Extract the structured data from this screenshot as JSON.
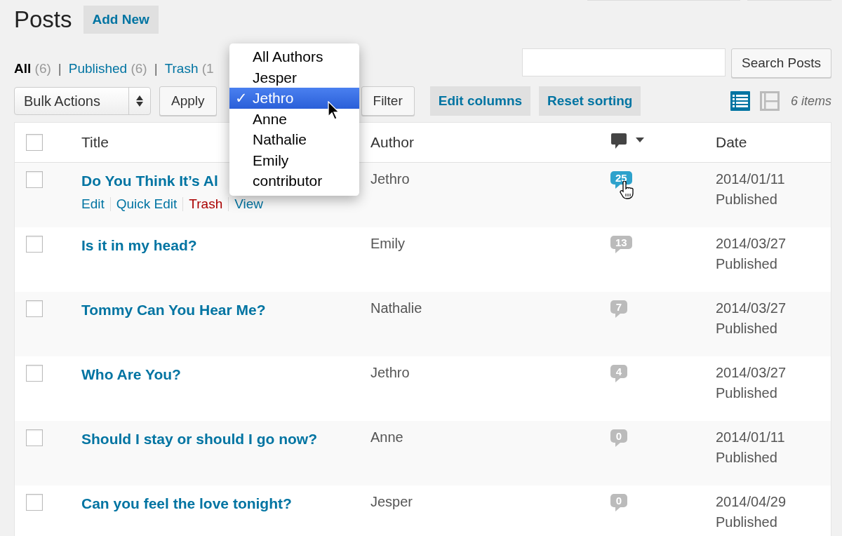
{
  "screen_meta": [
    {
      "kind": "wide"
    },
    {
      "kind": "narrow"
    }
  ],
  "page": {
    "title": "Posts",
    "add_new": "Add New"
  },
  "status_separator": "|",
  "status_links": [
    {
      "label": "All",
      "count": "(6)",
      "selected": true
    },
    {
      "label": "Published",
      "count": "(6)",
      "selected": false
    },
    {
      "label": "Trash",
      "count": "(1",
      "selected": false
    }
  ],
  "search": {
    "button": "Search Posts"
  },
  "toolbar": {
    "bulk_actions": "Bulk Actions",
    "apply": "Apply",
    "filter": "Filter",
    "edit_columns": "Edit columns",
    "reset_sorting": "Reset sorting",
    "items": "6 items"
  },
  "view_modes": [
    {
      "kind": "list",
      "selected": true
    },
    {
      "kind": "excerpt",
      "selected": false
    }
  ],
  "author_dropdown": {
    "check": "✓",
    "options": [
      {
        "label": "All Authors",
        "selected": false
      },
      {
        "label": "Jesper",
        "selected": false
      },
      {
        "label": "Jethro",
        "selected": true
      },
      {
        "label": "Anne",
        "selected": false
      },
      {
        "label": "Nathalie",
        "selected": false
      },
      {
        "label": "Emily",
        "selected": false
      },
      {
        "label": "contributor",
        "selected": false
      }
    ]
  },
  "table": {
    "select_all_checked": false,
    "columns": [
      "Title",
      "Author",
      "Date"
    ],
    "rows": [
      {
        "title": "Do You Think It’s Al",
        "actions": [
          {
            "label": "Edit",
            "kind": "normal"
          },
          {
            "label": "Quick Edit",
            "kind": "normal"
          },
          {
            "label": "Trash",
            "kind": "delete"
          },
          {
            "label": "View",
            "kind": "normal"
          }
        ],
        "checked": false,
        "author": "Jethro",
        "comments": "25",
        "hovered": true,
        "date": "2014/01/11",
        "status": "Published"
      },
      {
        "title": "Is it in my head?",
        "checked": false,
        "author": "Emily",
        "comments": "13",
        "hovered": false,
        "date": "2014/03/27",
        "status": "Published"
      },
      {
        "title": "Tommy Can You Hear Me?",
        "checked": false,
        "author": "Nathalie",
        "comments": "7",
        "hovered": false,
        "date": "2014/03/27",
        "status": "Published"
      },
      {
        "title": "Who Are You?",
        "checked": false,
        "author": "Jethro",
        "comments": "4",
        "hovered": false,
        "date": "2014/03/27",
        "status": "Published"
      },
      {
        "title": "Should I stay or should I go now?",
        "checked": false,
        "author": "Anne",
        "comments": "0",
        "hovered": false,
        "date": "2014/01/11",
        "status": "Published"
      },
      {
        "title": "Can you feel the love tonight?",
        "checked": false,
        "author": "Jesper",
        "comments": "0",
        "hovered": false,
        "date": "2014/04/29",
        "status": "Published"
      }
    ]
  }
}
